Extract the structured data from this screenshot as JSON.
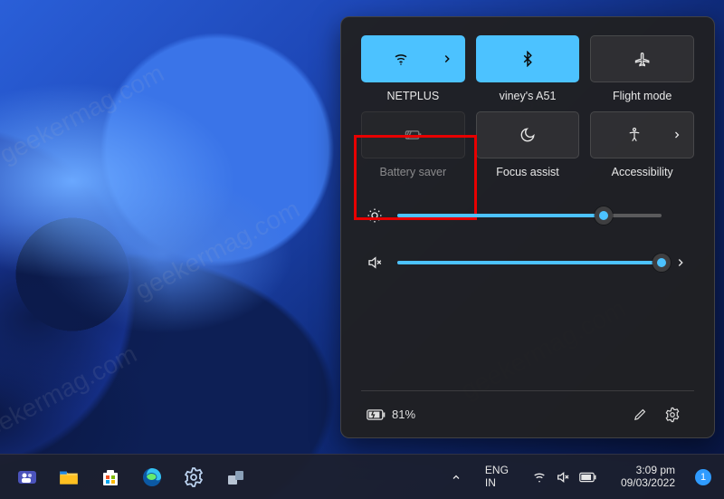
{
  "tiles": {
    "wifi": {
      "label": "NETPLUS",
      "active": true
    },
    "bluetooth": {
      "label": "viney's A51",
      "active": true
    },
    "flight": {
      "label": "Flight mode",
      "active": false
    },
    "battery": {
      "label": "Battery saver",
      "active": false,
      "disabled": true
    },
    "focus": {
      "label": "Focus assist",
      "active": false
    },
    "access": {
      "label": "Accessibility",
      "active": false
    }
  },
  "sliders": {
    "brightness": {
      "value": 78
    },
    "volume": {
      "value": 100,
      "muted": true
    }
  },
  "footer": {
    "battery_pct": "81%"
  },
  "taskbar": {
    "lang_top": "ENG",
    "lang_bot": "IN",
    "time": "3:09 pm",
    "date": "09/03/2022",
    "notif_count": "1"
  },
  "watermark": "geekermag.com"
}
